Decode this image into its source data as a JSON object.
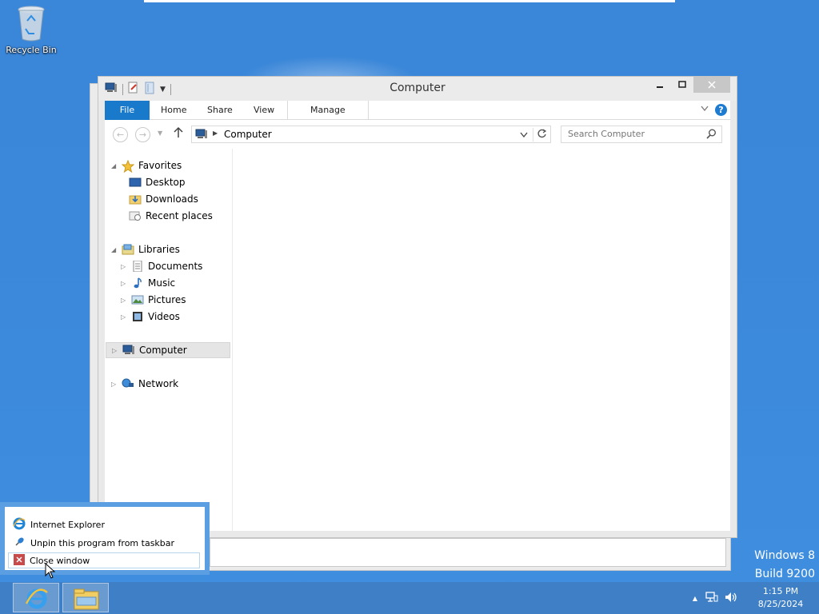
{
  "desktop": {
    "recycle_bin_label": "Recycle Bin",
    "watermark_line1": "Windows 8",
    "watermark_line2": "Build 9200"
  },
  "window": {
    "title": "Computer",
    "ribbon_tabs": [
      "File",
      "Home",
      "Share",
      "View",
      "Manage"
    ],
    "address_path": "Computer",
    "search_placeholder": "Search Computer"
  },
  "nav_tree": {
    "favorites": "Favorites",
    "desktop": "Desktop",
    "downloads": "Downloads",
    "recent_places": "Recent places",
    "libraries": "Libraries",
    "documents": "Documents",
    "music": "Music",
    "pictures": "Pictures",
    "videos": "Videos",
    "computer": "Computer",
    "network": "Network"
  },
  "jump_list": {
    "items": [
      "Internet Explorer",
      "Unpin this program from taskbar",
      "Close window"
    ]
  },
  "taskbar": {
    "time": "1:15 PM",
    "date": "8/25/2024"
  },
  "colors": {
    "accent_blue": "#1979ca",
    "desktop_bg": "#3b88da",
    "taskbar_bg": "#3f7fc5"
  }
}
